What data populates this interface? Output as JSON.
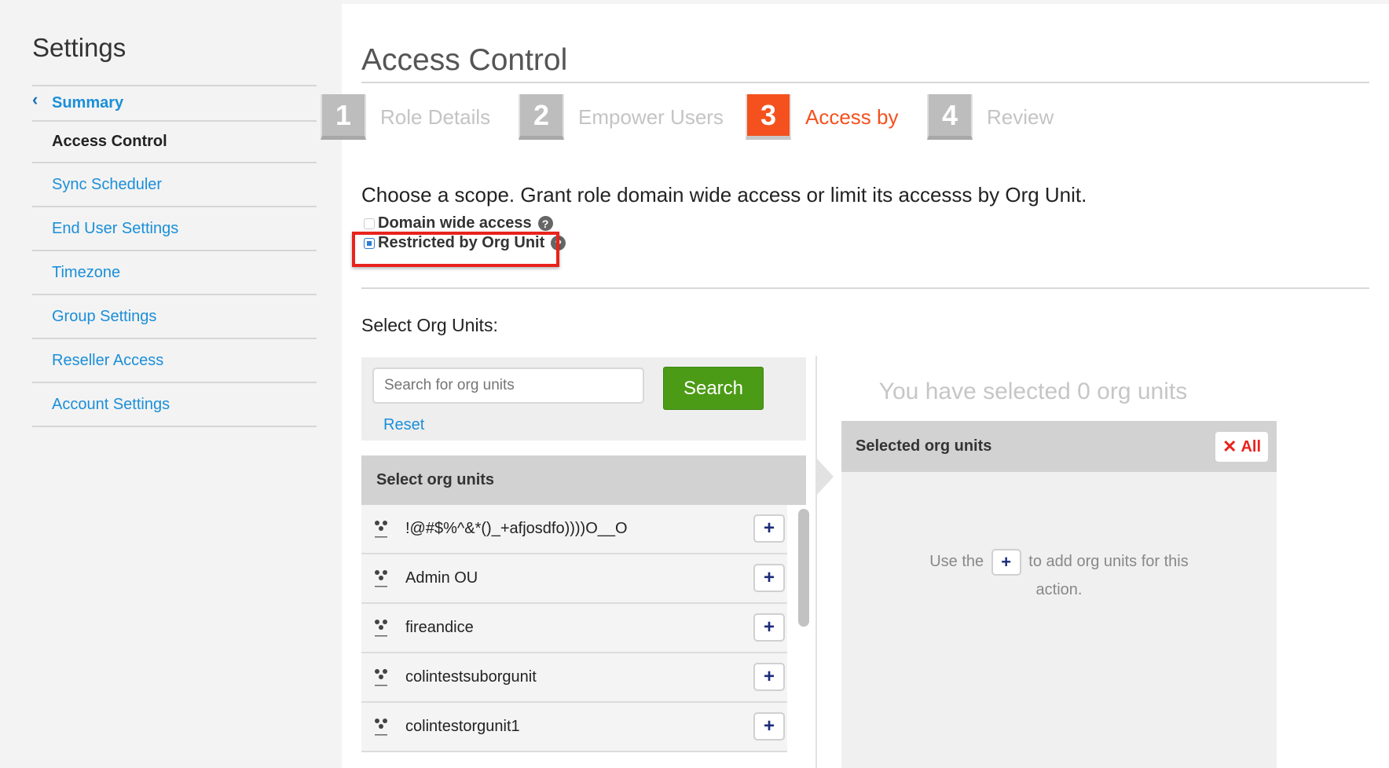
{
  "sidebar": {
    "title": "Settings",
    "items": [
      {
        "label": "Summary"
      },
      {
        "label": "Access Control"
      },
      {
        "label": "Sync Scheduler"
      },
      {
        "label": "End User Settings"
      },
      {
        "label": "Timezone"
      },
      {
        "label": "Group Settings"
      },
      {
        "label": "Reseller Access"
      },
      {
        "label": "Account Settings"
      }
    ]
  },
  "main": {
    "title": "Access Control",
    "steps": [
      {
        "num": "1",
        "label": "Role Details",
        "active": false
      },
      {
        "num": "2",
        "label": "Empower Users",
        "active": false
      },
      {
        "num": "3",
        "label": "Access by",
        "active": true
      },
      {
        "num": "4",
        "label": "Review",
        "active": false
      }
    ],
    "scope_text": "Choose a scope. Grant role domain wide access or limit its accesss by Org Unit.",
    "options": [
      {
        "label": "Domain wide access",
        "checked": false
      },
      {
        "label": "Restricted by Org Unit",
        "checked": true
      }
    ],
    "help_glyph": "?",
    "select_label": "Select Org Units:",
    "search": {
      "placeholder": "Search for org units",
      "button": "Search",
      "reset": "Reset"
    },
    "units_header": "Select org units",
    "units": [
      {
        "name": "!@#$%^&*()_+afjosdfo))))O__O"
      },
      {
        "name": "Admin OU"
      },
      {
        "name": "fireandice"
      },
      {
        "name": "colintestsuborgunit"
      },
      {
        "name": "colintestorgunit1"
      }
    ],
    "add_glyph": "+",
    "selected_count": "You have selected 0 org units",
    "selected_header": "Selected org units",
    "clear_all": {
      "x": "✕",
      "label": "All"
    },
    "hint": {
      "before": "Use the",
      "after": "to add org units for this",
      "line2": "action."
    }
  },
  "colors": {
    "accent": "#f4511e",
    "link": "#1a8fd8",
    "search_button": "#4c9b16",
    "highlight": "#e8231c"
  }
}
